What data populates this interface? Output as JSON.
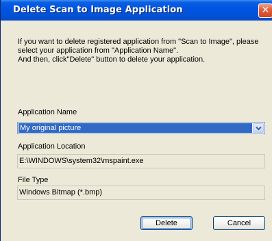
{
  "window": {
    "title": "Delete Scan to Image Application",
    "close_glyph": "✕"
  },
  "intro": {
    "line1": "If you want to delete registered application from \"Scan to Image\", please",
    "line2": "select your application from \"Application Name\".",
    "line3": "And then, click\"Delete\" button to delete your application."
  },
  "application_name": {
    "label": "Application Name",
    "selected": "My original picture"
  },
  "application_location": {
    "label": "Application Location",
    "value": "E:\\WINDOWS\\system32\\mspaint.exe"
  },
  "file_type": {
    "label": "File Type",
    "value": "Windows Bitmap (*.bmp)"
  },
  "buttons": {
    "delete": "Delete",
    "cancel": "Cancel"
  },
  "colors": {
    "titlebar": "#0054e3",
    "selection": "#316ac5",
    "dialog_bg": "#ece9d8",
    "close_button": "#d4441f"
  }
}
